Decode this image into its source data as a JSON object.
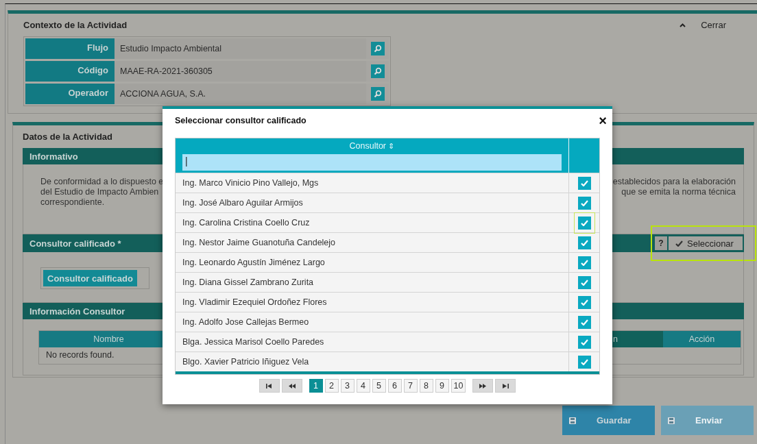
{
  "context_panel": {
    "title": "Contexto de la Actividad",
    "close_label": "Cerrar",
    "fields": [
      {
        "label": "Flujo",
        "value": "Estudio Impacto Ambiental"
      },
      {
        "label": "Código",
        "value": "MAAE-RA-2021-360305"
      },
      {
        "label": "Operador",
        "value": "ACCIONA AGUA, S.A."
      }
    ]
  },
  "activity_panel": {
    "title": "Datos de la Actividad",
    "informativo": {
      "title": "Informativo",
      "text_left": "De conformidad a lo dispuesto e\ndel Estudio de Impacto Ambien\ncorrespondiente.",
      "text_right": "establecidos para la elaboración\nque se emita la norma técnica"
    },
    "consultor": {
      "title": "Consultor calificado *",
      "help": "?",
      "select_label": "Seleccionar",
      "select_highlighted": true,
      "button": "Consultor calificado"
    },
    "info": {
      "title": "Información Consultor",
      "columns": [
        "Nombre",
        "n",
        "Acción"
      ],
      "empty": "No records found."
    }
  },
  "actions": [
    {
      "label": "Guardar",
      "disabled": false
    },
    {
      "label": "Enviar",
      "disabled": true
    }
  ],
  "dialog": {
    "title": "Seleccionar consultor calificado",
    "close": "×",
    "column": "Consultor",
    "sort": "⇕",
    "filter": "|",
    "rows": [
      {
        "name": "Ing. Marco Vinicio Pino Vallejo, Mgs",
        "checked": true,
        "highlighted": false
      },
      {
        "name": "Ing. José Albaro Aguilar Armijos",
        "checked": true,
        "highlighted": false
      },
      {
        "name": "Ing. Carolina Cristina Coello Cruz",
        "checked": true,
        "highlighted": true
      },
      {
        "name": "Ing. Nestor Jaime Guanotuña Candelejo",
        "checked": true,
        "highlighted": false
      },
      {
        "name": "Ing. Leonardo Agustín Jiménez Largo",
        "checked": true,
        "highlighted": false
      },
      {
        "name": "Ing. Diana Gissel Zambrano Zurita",
        "checked": true,
        "highlighted": false
      },
      {
        "name": "Ing. Vladimir Ezequiel Ordoñez Flores",
        "checked": true,
        "highlighted": false
      },
      {
        "name": "Ing. Adolfo Jose Callejas Bermeo",
        "checked": true,
        "highlighted": false
      },
      {
        "name": "Blga. Jessica Marisol Coello Paredes",
        "checked": true,
        "highlighted": false
      },
      {
        "name": "Blgo. Xavier Patricio Iñiguez Vela",
        "checked": true,
        "highlighted": false
      }
    ],
    "pages": [
      {
        "label": "1",
        "selected": true
      },
      {
        "label": "2",
        "selected": false
      },
      {
        "label": "3",
        "selected": false
      },
      {
        "label": "4",
        "selected": false
      },
      {
        "label": "5",
        "selected": false
      },
      {
        "label": "6",
        "selected": false
      },
      {
        "label": "7",
        "selected": false
      },
      {
        "label": "8",
        "selected": false
      },
      {
        "label": "9",
        "selected": false
      },
      {
        "label": "10",
        "selected": false
      }
    ]
  }
}
